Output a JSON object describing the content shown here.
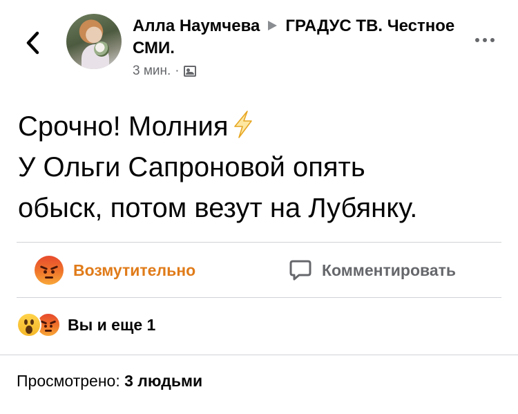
{
  "header": {
    "author": "Алла Наумчева",
    "group": "ГРАДУС ТВ. Честное СМИ.",
    "time": "3 мин.",
    "separator": "·",
    "audience_icon": "group-icon",
    "back_icon": "chevron-left-icon",
    "more_icon": "more-horizontal-icon"
  },
  "post": {
    "lines": [
      "Срочно! Молния",
      "У Ольги Сапроновой опять",
      "обыск, потом везут на Лубянку."
    ],
    "emoji": "lightning-icon"
  },
  "actions": {
    "reaction_label": "Возмутительно",
    "reaction_icon": "angry-reaction-icon",
    "reaction_color": "#e07b19",
    "comment_label": "Комментировать",
    "comment_icon": "comment-bubble-icon"
  },
  "reactions_summary": {
    "icons": [
      "wow-reaction-icon",
      "angry-reaction-icon"
    ],
    "text": "Вы и еще 1"
  },
  "views": {
    "label": "Просмотрено:",
    "count": "3 людьми"
  }
}
